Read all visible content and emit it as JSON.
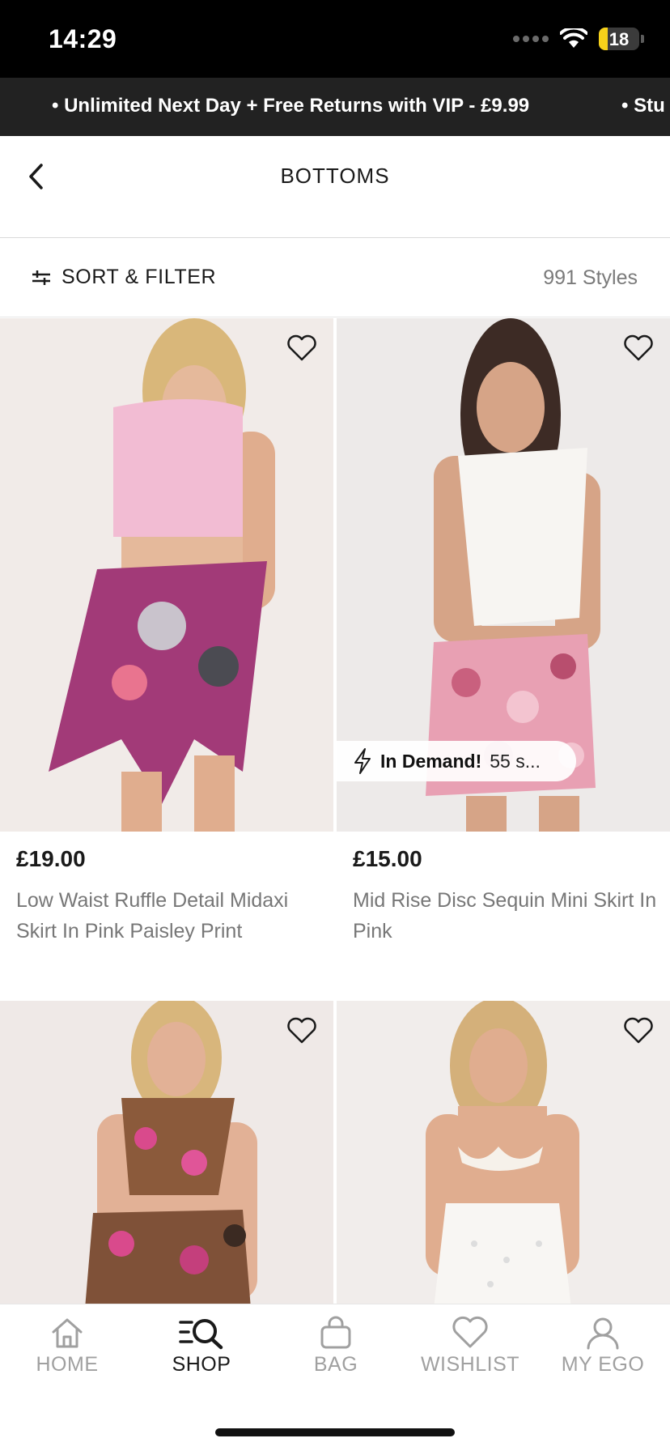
{
  "status": {
    "time": "14:29",
    "battery": "18",
    "battery_level": 0.18
  },
  "promo": {
    "items": [
      "• Unlimited Next Day + Free Returns with VIP - £9.99",
      "• Stu"
    ]
  },
  "header": {
    "title": "BOTTOMS",
    "back_icon": "chevron-left-icon"
  },
  "toolbar": {
    "sort_filter_label": "SORT & FILTER",
    "styles_count": "991 Styles",
    "filter_icon": "sliders-icon"
  },
  "products": [
    {
      "price": "£19.00",
      "name": "Low Waist Ruffle Detail Midaxi Skirt In Pink Paisley Print",
      "badge": null
    },
    {
      "price": "£15.00",
      "name": "Mid Rise Disc Sequin Mini Skirt In Pink",
      "badge": {
        "strong": "In Demand!",
        "rest": "55 s..."
      }
    },
    {
      "price": "",
      "name": "",
      "badge": null
    },
    {
      "price": "",
      "name": "",
      "badge": null
    }
  ],
  "tabbar": {
    "items": [
      {
        "label": "HOME",
        "icon": "home-icon",
        "active": false
      },
      {
        "label": "SHOP",
        "icon": "search-icon",
        "active": true
      },
      {
        "label": "BAG",
        "icon": "bag-icon",
        "active": false
      },
      {
        "label": "WISHLIST",
        "icon": "heart-icon",
        "active": false
      },
      {
        "label": "MY EGO",
        "icon": "user-icon",
        "active": false
      }
    ]
  },
  "colors": {
    "promo_bg": "#222222",
    "accent_battery": "#f7d21a",
    "muted_text": "#777777"
  }
}
